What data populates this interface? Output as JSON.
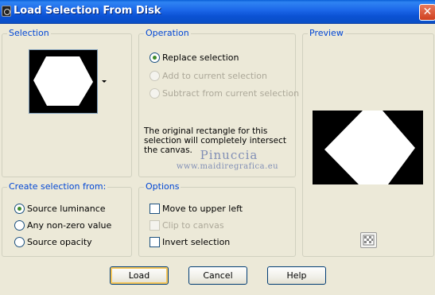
{
  "window": {
    "title": "Load Selection From Disk",
    "close_glyph": "✕"
  },
  "selection": {
    "group_label": "Selection"
  },
  "operation": {
    "group_label": "Operation",
    "options": [
      {
        "label": "Replace selection",
        "selected": true,
        "enabled": true
      },
      {
        "label": "Add to current selection",
        "selected": false,
        "enabled": false
      },
      {
        "label": "Subtract from current selection",
        "selected": false,
        "enabled": false
      }
    ],
    "description": "The original rectangle for this selection will completely intersect the canvas."
  },
  "preview": {
    "group_label": "Preview",
    "tool_icon": "checkerboard-icon"
  },
  "create_from": {
    "group_label": "Create selection from:",
    "options": [
      {
        "label": "Source luminance",
        "selected": true
      },
      {
        "label": "Any non-zero value",
        "selected": false
      },
      {
        "label": "Source opacity",
        "selected": false
      }
    ]
  },
  "options": {
    "group_label": "Options",
    "items": [
      {
        "label": "Move to upper left",
        "checked": false,
        "enabled": true
      },
      {
        "label": "Clip to canvas",
        "checked": false,
        "enabled": false
      },
      {
        "label": "Invert selection",
        "checked": false,
        "enabled": true
      }
    ]
  },
  "watermark": {
    "line1": "Pinuccia",
    "line2": "www.maidiregrafica.eu"
  },
  "buttons": {
    "load": "Load",
    "cancel": "Cancel",
    "help": "Help"
  },
  "colors": {
    "group_title": "#0046d5",
    "titlebar": "#0b52d4",
    "dialog_bg": "#ece9d8"
  }
}
